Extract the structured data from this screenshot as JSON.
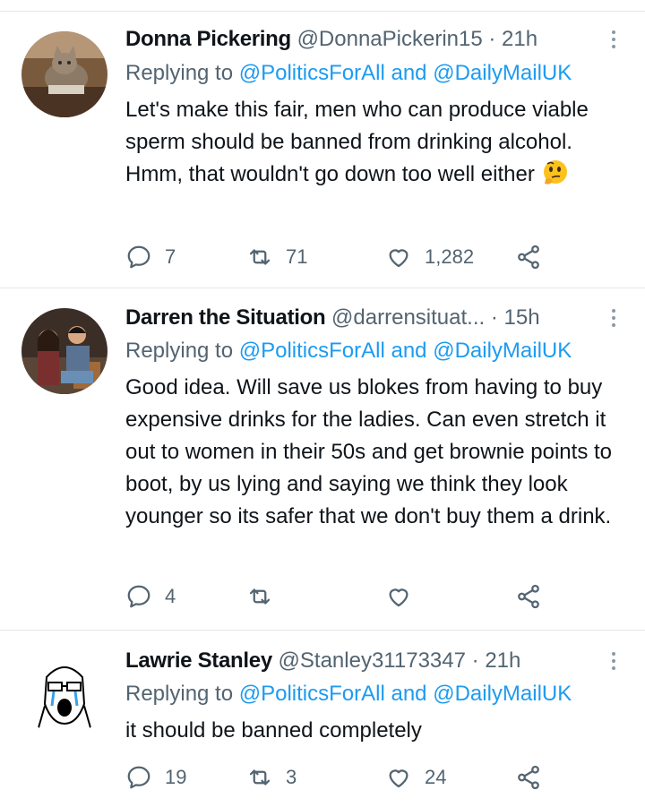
{
  "tweets": [
    {
      "name": "Donna Pickering",
      "handle": "@DonnaPickerin15",
      "time": "21h",
      "replying_prefix": "Replying to",
      "mention1": "@PoliticsForAll",
      "and": "and",
      "mention2": "@DailyMailUK",
      "text": "Let's make this fair, men who can produce viable sperm should be banned from drinking alcohol. Hmm, that wouldn't go down too well either",
      "emoji": "thinking-face",
      "replies": "7",
      "retweets": "71",
      "likes": "1,282"
    },
    {
      "name": "Darren the Situation",
      "handle": "@darrensituat...",
      "time": "15h",
      "replying_prefix": "Replying to",
      "mention1": "@PoliticsForAll",
      "and": "and",
      "mention2": "@DailyMailUK",
      "text": "Good idea. Will save us blokes from having to buy expensive drinks for the ladies. Can even stretch it out to women in their 50s and get brownie points to boot, by us lying and saying we think they look younger so its safer that we don't buy them a drink.",
      "replies": "4",
      "retweets": "",
      "likes": ""
    },
    {
      "name": "Lawrie Stanley",
      "handle": "@Stanley31173347",
      "time": "21h",
      "replying_prefix": "Replying to",
      "mention1": "@PoliticsForAll",
      "and": "and",
      "mention2": "@DailyMailUK",
      "text": "it should be banned completely",
      "replies": "19",
      "retweets": "3",
      "likes": "24"
    }
  ],
  "colors": {
    "mention": "#1d9bf0",
    "secondary": "#536471",
    "divider": "#e3e7ea"
  }
}
